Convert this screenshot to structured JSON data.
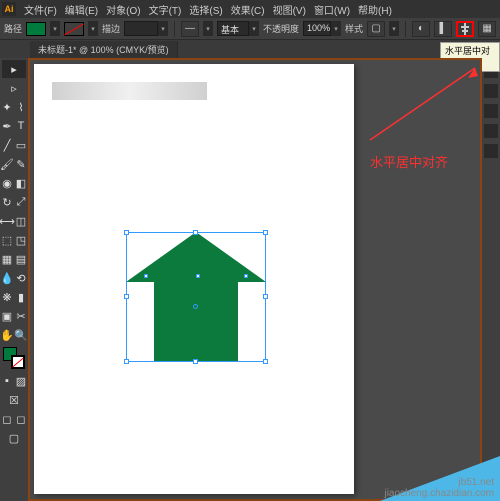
{
  "menu": {
    "items": [
      "文件(F)",
      "编辑(E)",
      "对象(O)",
      "文字(T)",
      "选择(S)",
      "效果(C)",
      "视图(V)",
      "窗口(W)",
      "帮助(H)"
    ]
  },
  "opt": {
    "pathLabel": "路径",
    "fillHex": "#007a3d",
    "strokeLabel": "描边",
    "strokeWeight": "",
    "brushLabel": "基本",
    "opacityLabel": "不透明度",
    "opacityValue": "100%",
    "styleLabel": "样式"
  },
  "align": {
    "tooltip": "水平居中对齐",
    "annotation": "水平居中对齐"
  },
  "doc": {
    "tab": "未标题-1* @ 100% (CMYK/预览)"
  },
  "shape": {
    "fill": "#0d7a3d"
  },
  "watermark": {
    "l1": "jb51.net",
    "l2": "jiaocheng.chazidian.com"
  }
}
